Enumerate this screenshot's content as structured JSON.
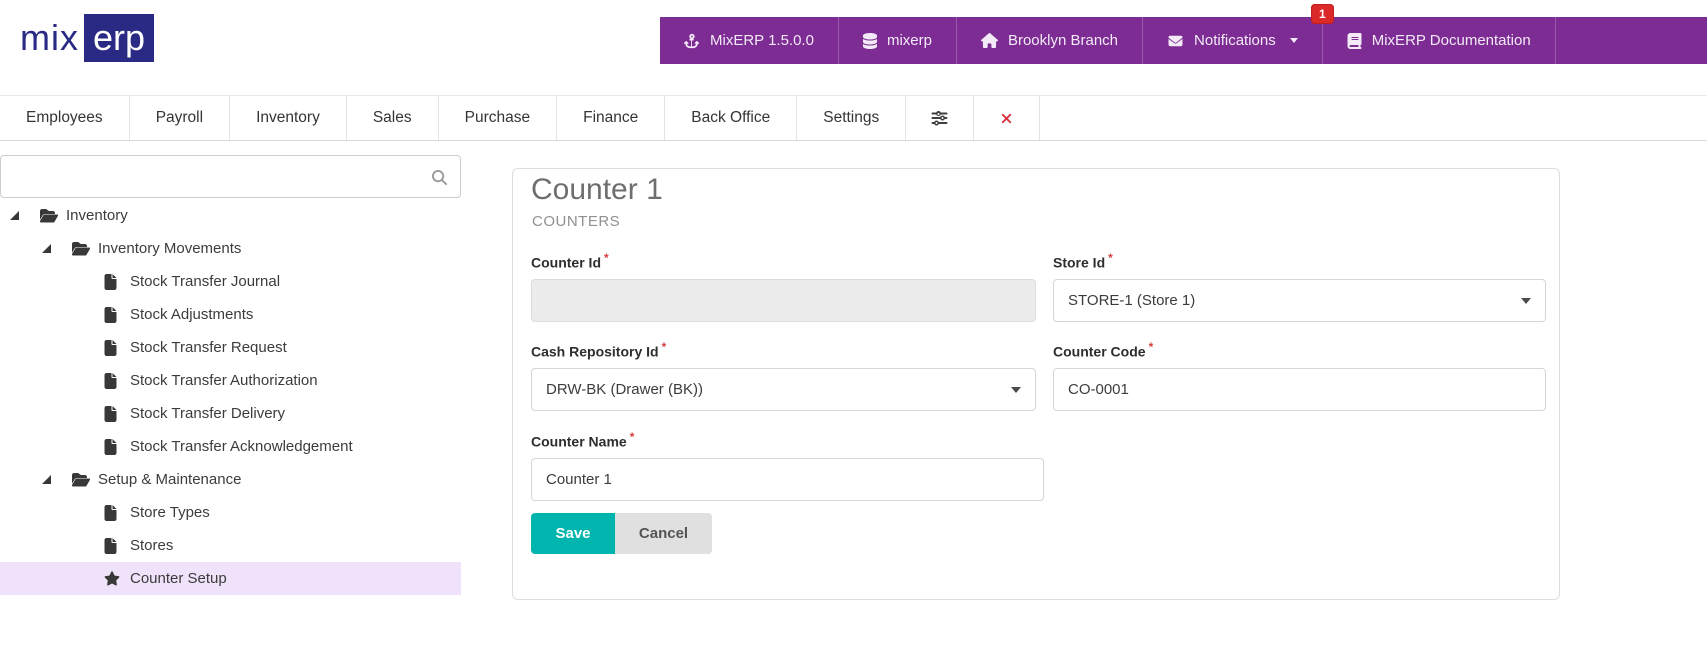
{
  "brand": {
    "logo_prefix": "mix",
    "logo_suffix": "erp"
  },
  "topnav": {
    "items": [
      {
        "label": "MixERP 1.5.0.0",
        "icon": "anchor"
      },
      {
        "label": "mixerp",
        "icon": "database"
      },
      {
        "label": "Brooklyn Branch",
        "icon": "home"
      },
      {
        "label": "Notifications",
        "icon": "envelope",
        "has_caret": true,
        "badge": "1"
      },
      {
        "label": "MixERP Documentation",
        "icon": "book"
      }
    ],
    "colors": {
      "bar": "#7c2c92",
      "badge": "#db2828"
    }
  },
  "menubar": {
    "tabs": [
      "Employees",
      "Payroll",
      "Inventory",
      "Sales",
      "Purchase",
      "Finance",
      "Back Office",
      "Settings"
    ],
    "icon_tabs": [
      {
        "icon": "sliders",
        "name": "customize-tab"
      },
      {
        "icon": "close",
        "name": "close-tab"
      }
    ]
  },
  "sidebar": {
    "search": {
      "value": "",
      "placeholder": ""
    },
    "tree": [
      {
        "depth": 0,
        "icon": "folder",
        "caret": true,
        "label": "Inventory"
      },
      {
        "depth": 1,
        "icon": "folder",
        "caret": true,
        "label": "Inventory Movements"
      },
      {
        "depth": 2,
        "icon": "file",
        "caret": false,
        "label": "Stock Transfer Journal"
      },
      {
        "depth": 2,
        "icon": "file",
        "caret": false,
        "label": "Stock Adjustments"
      },
      {
        "depth": 2,
        "icon": "file",
        "caret": false,
        "label": "Stock Transfer Request"
      },
      {
        "depth": 2,
        "icon": "file",
        "caret": false,
        "label": "Stock Transfer Authorization"
      },
      {
        "depth": 2,
        "icon": "file",
        "caret": false,
        "label": "Stock Transfer Delivery"
      },
      {
        "depth": 2,
        "icon": "file",
        "caret": false,
        "label": "Stock Transfer Acknowledgement"
      },
      {
        "depth": 1,
        "icon": "folder",
        "caret": true,
        "label": "Setup & Maintenance"
      },
      {
        "depth": 2,
        "icon": "file",
        "caret": false,
        "label": "Store Types"
      },
      {
        "depth": 2,
        "icon": "file",
        "caret": false,
        "label": "Stores"
      },
      {
        "depth": 2,
        "icon": "star",
        "caret": false,
        "label": "Counter Setup",
        "selected": true
      }
    ]
  },
  "form": {
    "title": "Counter 1",
    "subtitle": "COUNTERS",
    "required_marker": "*",
    "fields": {
      "counter_id": {
        "label": "Counter Id",
        "value": "",
        "type": "text-disabled"
      },
      "store_id": {
        "label": "Store Id",
        "value": "STORE-1 (Store 1)",
        "type": "select"
      },
      "cash_repository_id": {
        "label": "Cash Repository Id",
        "value": "DRW-BK (Drawer (BK))",
        "type": "select"
      },
      "counter_code": {
        "label": "Counter Code",
        "value": "CO-0001",
        "type": "text"
      },
      "counter_name": {
        "label": "Counter Name",
        "value": "Counter 1",
        "type": "text"
      }
    },
    "buttons": {
      "save": "Save",
      "cancel": "Cancel"
    },
    "colors": {
      "save": "#00b5ad",
      "required": "#d23f3f",
      "selected_row": "#f0e2fa"
    }
  }
}
